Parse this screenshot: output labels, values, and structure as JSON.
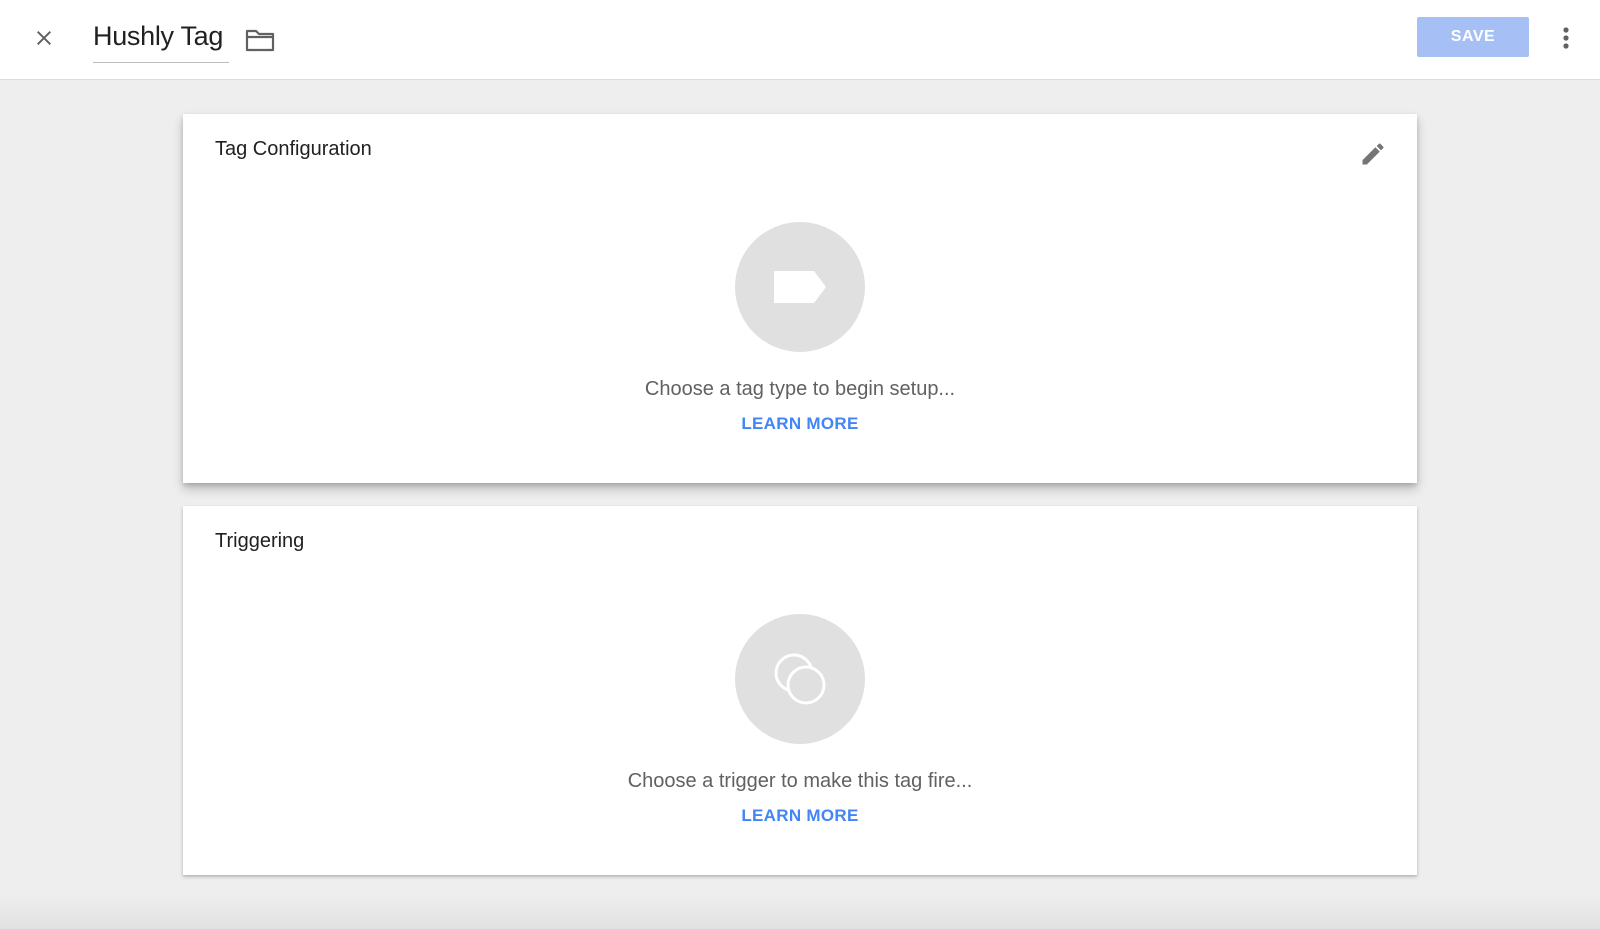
{
  "header": {
    "close_icon": "close-icon",
    "title": "Hushly Tag",
    "folder_icon": "folder-icon",
    "save_label": "SAVE",
    "save_color": "#a6bff5",
    "more_icon": "more-vert-icon"
  },
  "tag_configuration": {
    "title": "Tag Configuration",
    "edit_icon": "pencil-icon",
    "placeholder_icon": "tag-icon",
    "prompt": "Choose a tag type to begin setup...",
    "learn_more": "LEARN MORE"
  },
  "triggering": {
    "title": "Triggering",
    "placeholder_icon": "trigger-icon",
    "prompt": "Choose a trigger to make this tag fire...",
    "learn_more": "LEARN MORE"
  },
  "colors": {
    "accent": "#4285f4",
    "background": "#eeeeee",
    "placeholder_circle": "#e0e0e0"
  }
}
